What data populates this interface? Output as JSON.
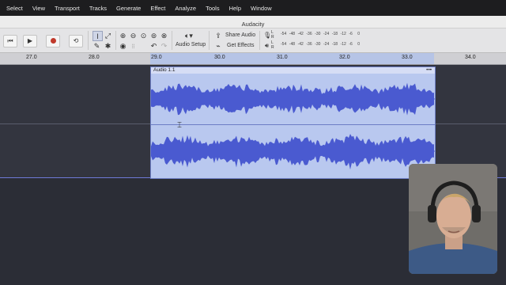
{
  "menubar": {
    "items": [
      "Select",
      "View",
      "Transport",
      "Tracks",
      "Generate",
      "Effect",
      "Analyze",
      "Tools",
      "Help",
      "Window"
    ]
  },
  "window": {
    "title": "Audacity"
  },
  "toolbar": {
    "audio_setup_label": "Audio Setup",
    "share_audio_label": "Share Audio",
    "get_effects_label": "Get Effects",
    "meter_ticks": [
      "-54",
      "-48",
      "-42",
      "-36",
      "-30",
      "-24",
      "-18",
      "-12",
      "-6",
      "0"
    ],
    "meter_channels": [
      "L",
      "R"
    ]
  },
  "ruler": {
    "ticks": [
      "27.0",
      "28.0",
      "29.0",
      "30.0",
      "31.0",
      "32.0",
      "33.0",
      "34.0"
    ]
  },
  "clip": {
    "name": "Audio 1.1",
    "menu": "•••"
  },
  "colors": {
    "waveform": "#4a5ad0",
    "clip_bg": "#b9c8ef",
    "selection": "#b6c4e6",
    "record": "#c0392b"
  }
}
